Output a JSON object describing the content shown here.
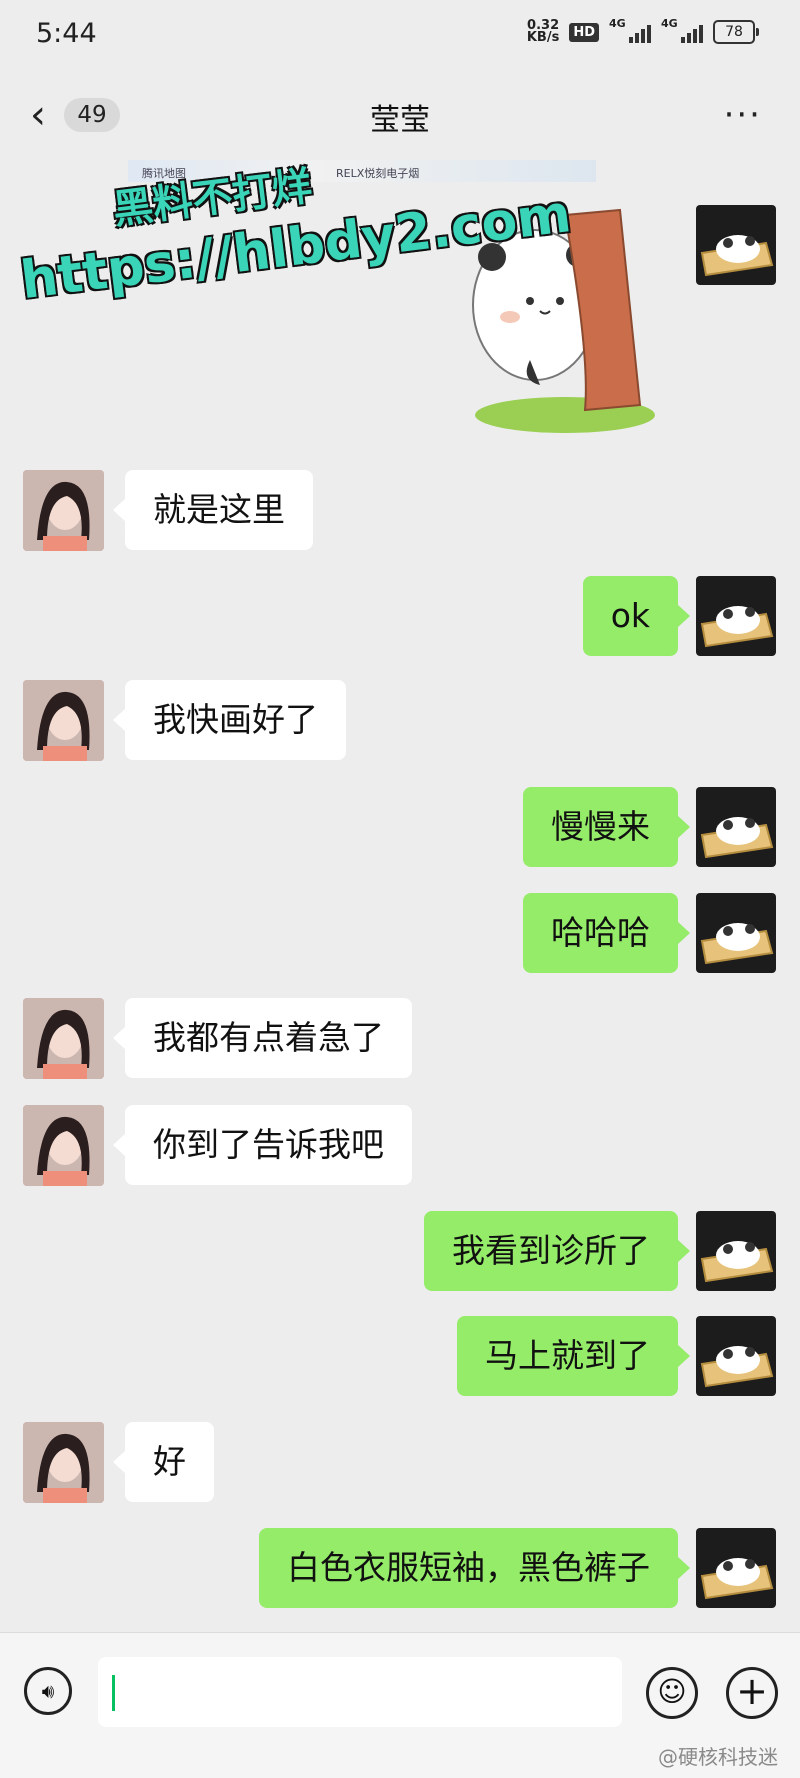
{
  "status_bar": {
    "time": "5:44",
    "net_speed": "0.32",
    "net_unit": "KB/s",
    "hd_badge": "HD",
    "signal_1": "4G",
    "signal_2": "4G",
    "battery": "78"
  },
  "nav": {
    "back_count": "49",
    "title": "莹莹",
    "more": "···"
  },
  "map_strip": {
    "left_label": "腾讯地图",
    "mid_label": "RELX悦刻电子烟"
  },
  "watermark": {
    "line1": "黑料不打烊",
    "line2": "https://hlbdy2.com"
  },
  "messages": [
    {
      "side": "self",
      "type": "sticker",
      "sticker": "panda-peeking-behind-tree-sticker"
    },
    {
      "side": "peer",
      "text": "就是这里"
    },
    {
      "side": "self",
      "text": "ok"
    },
    {
      "side": "peer",
      "text": "我快画好了"
    },
    {
      "side": "self",
      "text": "慢慢来"
    },
    {
      "side": "self",
      "text": "哈哈哈"
    },
    {
      "side": "peer",
      "text": "我都有点着急了"
    },
    {
      "side": "peer",
      "text": "你到了告诉我吧"
    },
    {
      "side": "self",
      "text": "我看到诊所了"
    },
    {
      "side": "self",
      "text": "马上就到了"
    },
    {
      "side": "peer",
      "text": "好"
    },
    {
      "side": "self",
      "text": "白色衣服短袖，黑色裤子"
    }
  ],
  "input_bar": {
    "voice_icon": "voice-icon",
    "emoji_icon": "emoji-icon",
    "plus_icon": "plus-icon",
    "credit": "@硬核科技迷"
  },
  "colors": {
    "self_bubble": "#95ec69",
    "peer_bubble": "#ffffff",
    "background": "#ededed",
    "watermark": "#3ad4b8"
  }
}
